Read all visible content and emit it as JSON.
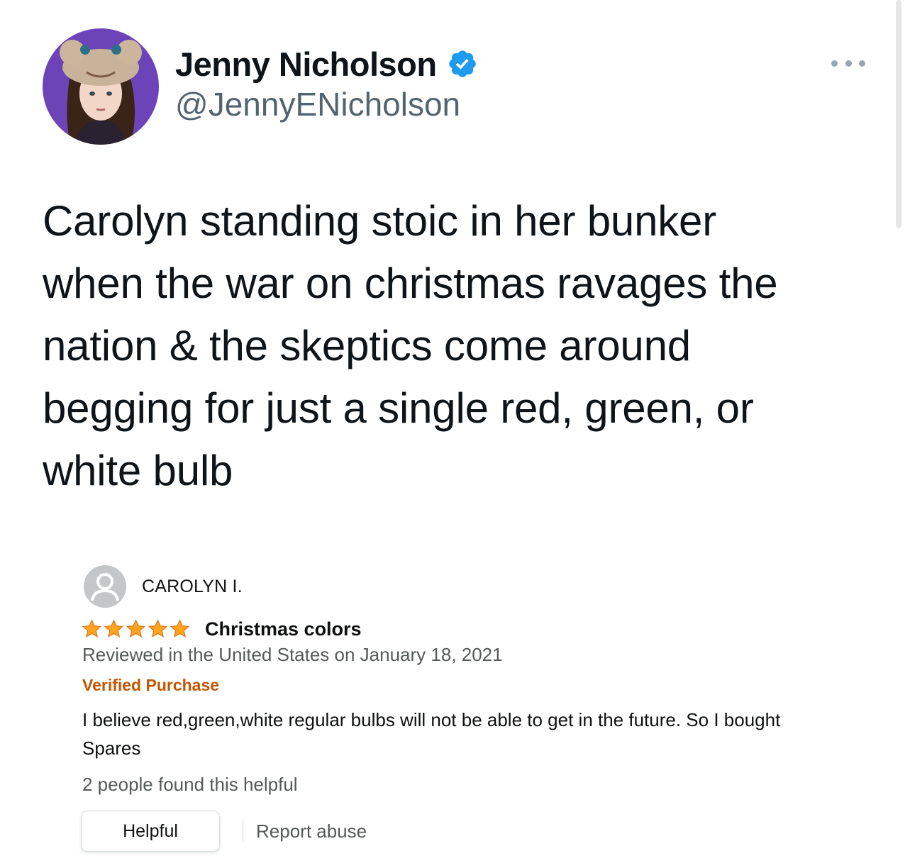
{
  "author": {
    "display_name": "Jenny Nicholson",
    "handle": "@JennyENicholson",
    "verified_icon": "verified-badge-icon",
    "avatar_background": "#6d44b8"
  },
  "more_icon": "ellipsis-icon",
  "tweet": {
    "lines": [
      "Carolyn standing stoic in her bunker",
      "when the war on christmas ravages the",
      "nation & the skeptics come around",
      "begging for just a single red, green, or",
      "white bulb"
    ]
  },
  "review": {
    "reviewer_name": "CAROLYN I.",
    "rating": 5,
    "rating_max": 5,
    "title": "Christmas colors",
    "date": "Reviewed in the United States on January 18, 2021",
    "verified_label": "Verified Purchase",
    "body_lines": [
      "I believe red,green,white regular bulbs will not be able to get in the future. So I bought",
      "Spares"
    ],
    "helpful_count_text": "2 people found this helpful",
    "helpful_button": "Helpful",
    "report_link": "Report abuse",
    "star_color": "#ffa41c",
    "verified_color": "#c45500"
  }
}
